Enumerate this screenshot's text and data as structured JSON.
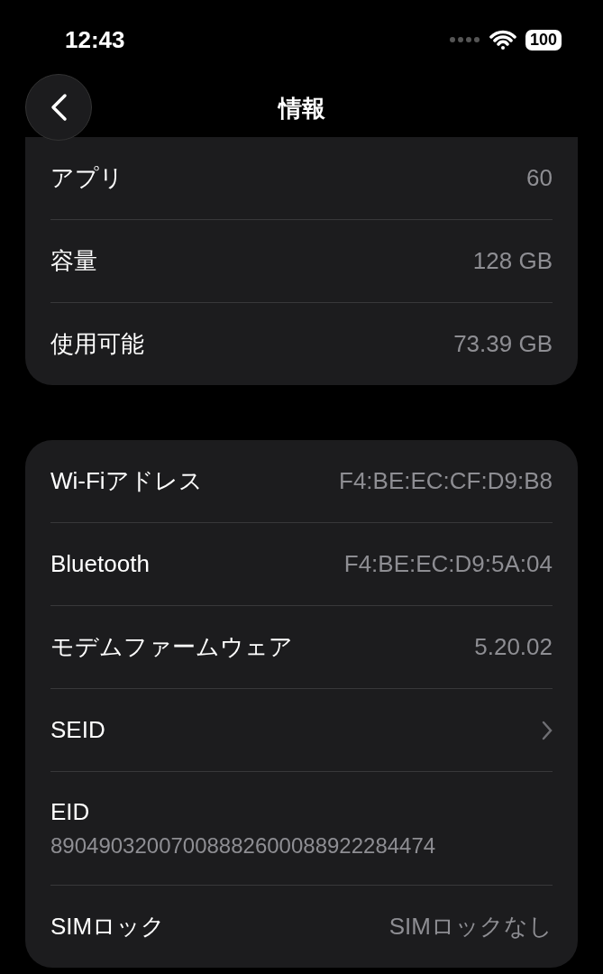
{
  "status_bar": {
    "time": "12:43",
    "battery": "100"
  },
  "nav": {
    "title": "情報"
  },
  "groups": [
    {
      "rows": [
        {
          "kind": "value",
          "label": "アプリ",
          "value": "60"
        },
        {
          "kind": "value",
          "label": "容量",
          "value": "128 GB"
        },
        {
          "kind": "value",
          "label": "使用可能",
          "value": "73.39 GB"
        }
      ]
    },
    {
      "rows": [
        {
          "kind": "value",
          "label": "Wi-Fiアドレス",
          "value": "F4:BE:EC:CF:D9:B8"
        },
        {
          "kind": "value",
          "label": "Bluetooth",
          "value": "F4:BE:EC:D9:5A:04"
        },
        {
          "kind": "value",
          "label": "モデムファームウェア",
          "value": "5.20.02"
        },
        {
          "kind": "link",
          "label": "SEID"
        },
        {
          "kind": "stacked",
          "label": "EID",
          "value": "89049032007008882600088922284474"
        },
        {
          "kind": "value",
          "label": "SIMロック",
          "value": "SIMロックなし"
        }
      ]
    }
  ]
}
